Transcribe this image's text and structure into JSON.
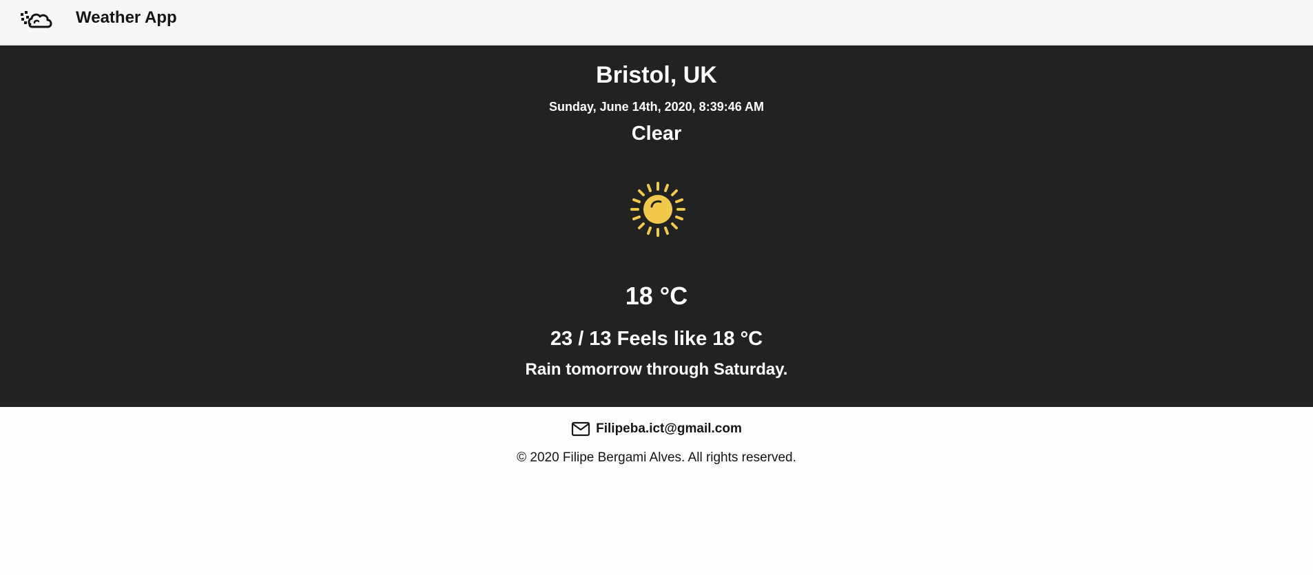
{
  "header": {
    "logo_icon": "cloud-dots-icon",
    "title": "Weather App"
  },
  "weather": {
    "location": "Bristol, UK",
    "datetime": "Sunday, June 14th, 2020, 8:39:46 AM",
    "condition": "Clear",
    "condition_icon": "sun-icon",
    "temperature": "18 °C",
    "range_feels": "23 / 13 Feels like 18 °C",
    "forecast": "Rain tomorrow through Saturday."
  },
  "footer": {
    "email_icon": "mail-icon",
    "email": "Filipeba.ict@gmail.com",
    "copyright": "© 2020 Filipe Bergami Alves. All rights reserved."
  },
  "colors": {
    "header_bg": "#f6f7f8",
    "hero_bg": "#222222",
    "sun": "#f2c94c",
    "text_light": "#ffffff",
    "text_dark": "#141414"
  }
}
